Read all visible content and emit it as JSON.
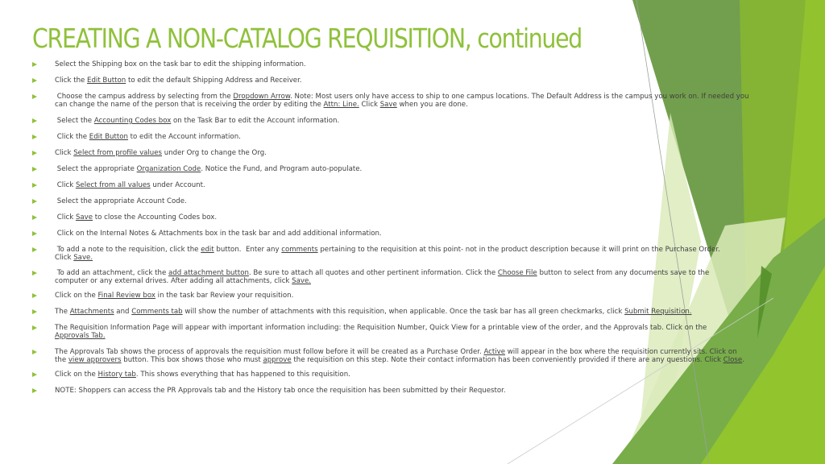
{
  "slide": {
    "title": "CREATING A NON-CATALOG REQUISITION, continued",
    "accent_color": "#8fc13a",
    "text_color": "#404040",
    "bullet_icon": "triangle-right-arrow",
    "bullets": [
      {
        "segments": [
          {
            "t": "Select the Shipping box on the task bar to edit the shipping information."
          }
        ]
      },
      {
        "segments": [
          {
            "t": "Click the "
          },
          {
            "t": "Edit Button",
            "u": true
          },
          {
            "t": " to edit the default Shipping Address and Receiver."
          }
        ]
      },
      {
        "segments": [
          {
            "t": " Choose the campus address by selecting from the "
          },
          {
            "t": "Dropdown Arrow",
            "u": true
          },
          {
            "t": ". Note: Most users only have access to ship to one campus locations. The Default Address is the campus you work on. If needed you\ncan change the name of the person that is receiving the order by editing the "
          },
          {
            "t": "Attn: Line.",
            "u": true
          },
          {
            "t": " Click "
          },
          {
            "t": "Save",
            "u": true
          },
          {
            "t": " when you are done."
          }
        ]
      },
      {
        "segments": [
          {
            "t": " Select the "
          },
          {
            "t": "Accounting Codes box",
            "u": true
          },
          {
            "t": " on the Task Bar to edit the Account information."
          }
        ]
      },
      {
        "segments": [
          {
            "t": " Click the "
          },
          {
            "t": "Edit Button",
            "u": true
          },
          {
            "t": " to edit the Account information."
          }
        ]
      },
      {
        "segments": [
          {
            "t": "Click "
          },
          {
            "t": "Select from profile values",
            "u": true
          },
          {
            "t": " under Org to change the Org."
          }
        ]
      },
      {
        "segments": [
          {
            "t": " Select the appropriate "
          },
          {
            "t": "Organization Code",
            "u": true
          },
          {
            "t": ". Notice the Fund, and Program auto-populate."
          }
        ]
      },
      {
        "segments": [
          {
            "t": " Click "
          },
          {
            "t": "Select from all values",
            "u": true
          },
          {
            "t": " under Account."
          }
        ]
      },
      {
        "segments": [
          {
            "t": " Select the appropriate Account Code."
          }
        ]
      },
      {
        "segments": [
          {
            "t": " Click "
          },
          {
            "t": "Save",
            "u": true
          },
          {
            "t": " to close the Accounting Codes box."
          }
        ]
      },
      {
        "segments": [
          {
            "t": " Click on the Internal Notes & Attachments box in the task bar and add additional information."
          }
        ]
      },
      {
        "segments": [
          {
            "t": " To add a note to the requisition, click the "
          },
          {
            "t": "edit",
            "u": true
          },
          {
            "t": " button.  Enter any "
          },
          {
            "t": "comments",
            "u": true
          },
          {
            "t": " pertaining to the requisition at this point- not in the product description because it will print on the Purchase Order.\nClick "
          },
          {
            "t": "Save.",
            "u": true
          }
        ]
      },
      {
        "segments": [
          {
            "t": " To add an attachment, click the "
          },
          {
            "t": "add attachment button",
            "u": true
          },
          {
            "t": ". Be sure to attach all quotes and other pertinent information. Click the "
          },
          {
            "t": "Choose File",
            "u": true
          },
          {
            "t": " button to select from any documents save to the\ncomputer or any external drives. After adding all attachments, click "
          },
          {
            "t": "Save.",
            "u": true
          }
        ]
      },
      {
        "segments": [
          {
            "t": "Click on the "
          },
          {
            "t": "Final Review box",
            "u": true
          },
          {
            "t": " in the task bar Review your requisition."
          }
        ]
      },
      {
        "segments": [
          {
            "t": "The "
          },
          {
            "t": "Attachments",
            "u": true
          },
          {
            "t": " and "
          },
          {
            "t": "Comments tab",
            "u": true
          },
          {
            "t": " will show the number of attachments with this requisition, when applicable. Once the task bar has all green checkmarks, click "
          },
          {
            "t": "Submit Requisition.",
            "u": true
          }
        ]
      },
      {
        "segments": [
          {
            "t": "The Requisition Information Page will appear with important information including: the Requisition Number, Quick View for a printable view of the order, and the Approvals tab. Click on the\n"
          },
          {
            "t": "Approvals Tab.",
            "u": true
          }
        ]
      },
      {
        "segments": [
          {
            "t": "The Approvals Tab shows the process of approvals the requisition must follow before it will be created as a Purchase Order. "
          },
          {
            "t": "Active",
            "u": true
          },
          {
            "t": " will appear in the box where the requisition currently sits. Click on\nthe "
          },
          {
            "t": "view approvers",
            "u": true
          },
          {
            "t": " button. This box shows those who must "
          },
          {
            "t": "approve",
            "u": true
          },
          {
            "t": " the requisition on this step. Note their contact information has been conveniently provided if there are any questions. Click "
          },
          {
            "t": "Close",
            "u": true
          },
          {
            "t": "."
          }
        ]
      },
      {
        "segments": [
          {
            "t": "Click on the "
          },
          {
            "t": "History tab",
            "u": true
          },
          {
            "t": ". This shows everything that has happened to this requisition."
          }
        ]
      },
      {
        "segments": [
          {
            "t": "NOTE: Shoppers can access the PR Approvals tab and the History tab once the requisition has been submitted by their Requestor."
          }
        ]
      }
    ]
  }
}
